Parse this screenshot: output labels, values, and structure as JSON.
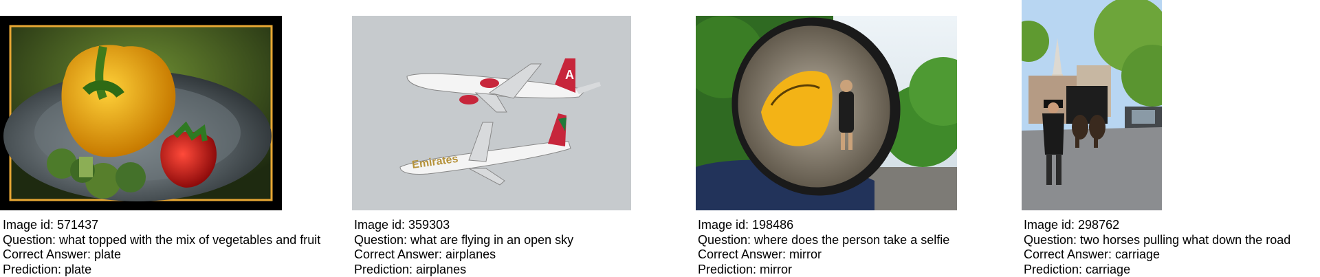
{
  "panels": [
    {
      "image_id": "Image id: 571437",
      "question": "Question: what topped with the mix of vegetables and fruit",
      "correct_answer": "Correct Answer: plate",
      "prediction": "Prediction: plate"
    },
    {
      "image_id": "Image id: 359303",
      "question": "Question: what are flying in an open sky",
      "correct_answer": "Correct Answer: airplanes",
      "prediction": "Prediction: airplanes"
    },
    {
      "image_id": "Image id: 198486",
      "question": "Question: where does the person take a selfie",
      "correct_answer": "Correct Answer: mirror",
      "prediction": "Prediction: mirror"
    },
    {
      "image_id": "Image id: 298762",
      "question": "Question: two horses pulling what down the road",
      "correct_answer": "Correct Answer: carriage",
      "prediction": "Prediction: carriage"
    }
  ],
  "aircraft_livery": {
    "top_plane_tail_mark": "A",
    "bottom_plane_name": "Emirates"
  }
}
